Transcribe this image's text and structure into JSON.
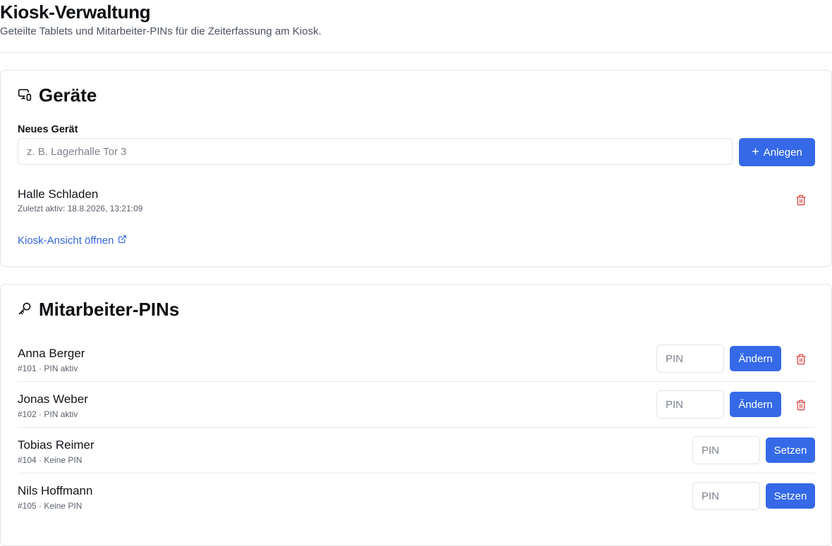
{
  "header": {
    "title": "Kiosk-Verwaltung",
    "subtitle": "Geteilte Tablets und Mitarbeiter-PINs für die Zeiterfassung am Kiosk."
  },
  "devices": {
    "title": "Geräte",
    "new_label": "Neues Gerät",
    "new_placeholder": "z. B. Lagerhalle Tor 3",
    "new_value": "",
    "create_button": "Anlegen",
    "items": [
      {
        "name": "Halle Schladen",
        "meta": "Zuletzt aktiv: 18.8.2026, 13:21:09"
      }
    ],
    "kiosk_link": "Kiosk-Ansicht öffnen"
  },
  "pins": {
    "title": "Mitarbeiter-PINs",
    "pin_placeholder": "PIN",
    "employees": [
      {
        "name": "Anna Berger",
        "meta": "#101 · PIN aktiv",
        "action": "Ändern"
      },
      {
        "name": "Jonas Weber",
        "meta": "#102 · PIN aktiv",
        "action": "Ändern"
      },
      {
        "name": "Tobias Reimer",
        "meta": "#104 · Keine PIN",
        "action": "Setzen"
      },
      {
        "name": "Nils Hoffmann",
        "meta": "#105 · Keine PIN",
        "action": "Setzen"
      }
    ]
  },
  "colors": {
    "accent": "#3569e8",
    "danger": "#e04444",
    "link": "#3267d6"
  },
  "icons": {
    "devices": "devices-icon",
    "pins": "key-icon",
    "delete": "trash-icon",
    "external": "external-link-icon",
    "add": "plus-icon"
  }
}
